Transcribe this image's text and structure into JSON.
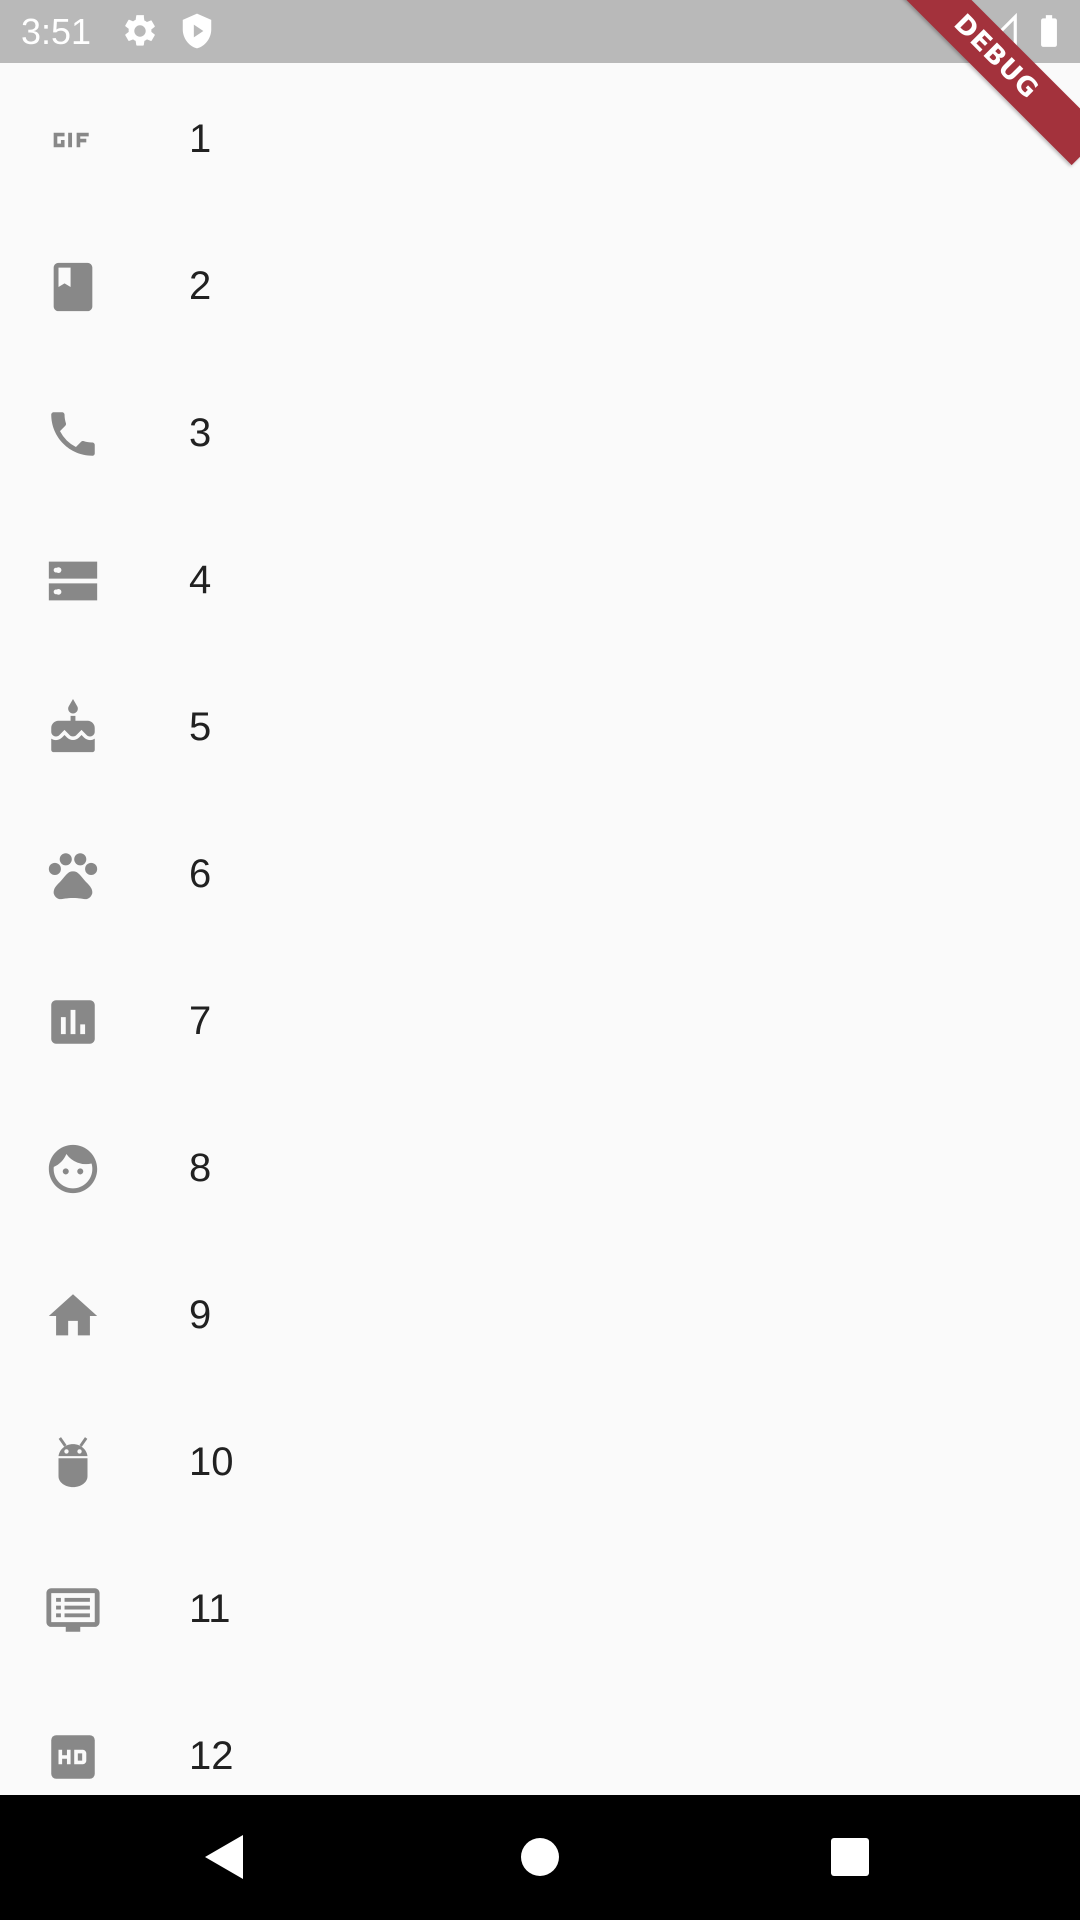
{
  "status_bar": {
    "time": "3:51",
    "background": "#b9b9b9",
    "icons": [
      "settings-icon",
      "play-protect-icon",
      "wifi-icon",
      "cellular-signal-icon",
      "battery-icon"
    ]
  },
  "debug_banner": {
    "label": "DEBUG",
    "color": "#a3323c"
  },
  "list": {
    "icon_color": "#888888",
    "items": [
      {
        "icon": "gif-icon",
        "label": "1"
      },
      {
        "icon": "book-icon",
        "label": "2"
      },
      {
        "icon": "phone-icon",
        "label": "3"
      },
      {
        "icon": "storage-icon",
        "label": "4"
      },
      {
        "icon": "cake-icon",
        "label": "5"
      },
      {
        "icon": "pets-icon",
        "label": "6"
      },
      {
        "icon": "bar-chart-icon",
        "label": "7"
      },
      {
        "icon": "face-icon",
        "label": "8"
      },
      {
        "icon": "home-icon",
        "label": "9"
      },
      {
        "icon": "android-icon",
        "label": "10"
      },
      {
        "icon": "subtitles-icon",
        "label": "11"
      },
      {
        "icon": "hd-icon",
        "label": "12"
      }
    ]
  },
  "nav_bar": {
    "buttons": [
      "back-button",
      "home-button",
      "recents-button"
    ]
  }
}
